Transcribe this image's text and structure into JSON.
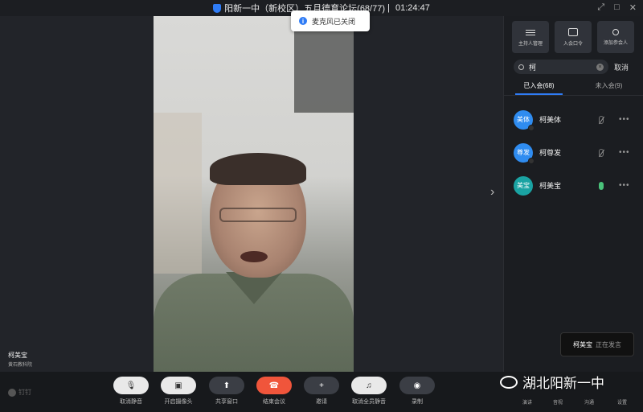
{
  "window": {
    "title": "阳新一中（新校区）五月德育论坛(68/77)",
    "time": "01:24:47",
    "controls": [
      "⤢",
      "□",
      "✕"
    ]
  },
  "toast": {
    "text": "麦克风已关闭"
  },
  "speaker": {
    "name": "柯美宝",
    "org": "黄石教科院"
  },
  "panel": {
    "actions": [
      {
        "label": "主持人管理",
        "icon": "sliders-icon"
      },
      {
        "label": "入会口令",
        "icon": "share-link-icon"
      },
      {
        "label": "添加参会人",
        "icon": "user-add-icon"
      }
    ],
    "search": {
      "value": "柯",
      "cancel": "取消"
    },
    "tabs": [
      {
        "label": "已入会(68)",
        "active": true
      },
      {
        "label": "未入会(9)",
        "active": false
      }
    ],
    "participants": [
      {
        "avatar": "美体",
        "name": "柯美体",
        "avatar_color": "#2f8cf0",
        "mic": "muted"
      },
      {
        "avatar": "尊发",
        "name": "柯尊发",
        "avatar_color": "#2f8cf0",
        "mic": "muted"
      },
      {
        "avatar": "美宝",
        "name": "柯美宝",
        "avatar_color": "#1aa3a3",
        "mic": "active"
      }
    ]
  },
  "speaking": {
    "name": "柯美宝",
    "status": "正在发言"
  },
  "toolbar": {
    "logo": "钉钉",
    "buttons": [
      {
        "label": "取消静音",
        "glyph": "🎙"
      },
      {
        "label": "开启摄像头",
        "glyph": "▣"
      },
      {
        "label": "共享窗口",
        "glyph": "⬆"
      },
      {
        "label": "结束会议",
        "glyph": "☎"
      },
      {
        "label": "邀请",
        "glyph": "+"
      },
      {
        "label": "取消全员静音",
        "glyph": "♫"
      },
      {
        "label": "录制",
        "glyph": "◉"
      }
    ],
    "right": [
      "演讲",
      "音视",
      "沟通",
      "设置"
    ]
  },
  "watermark": {
    "text": "湖北阳新一中"
  }
}
